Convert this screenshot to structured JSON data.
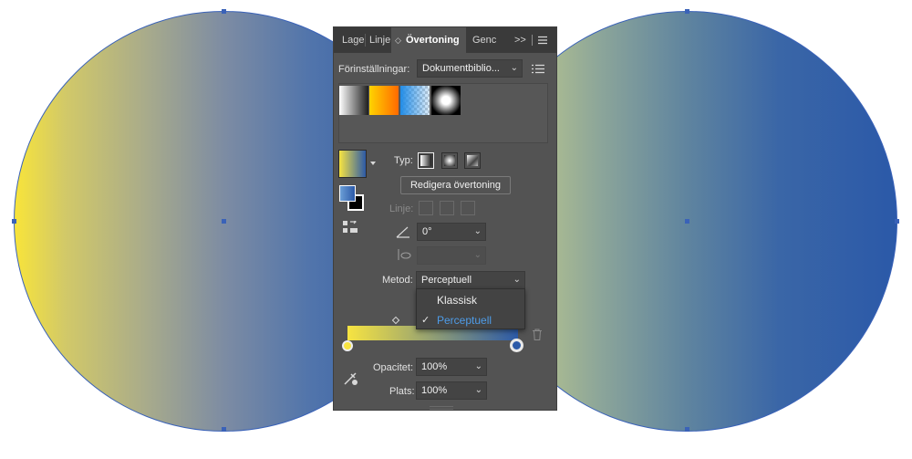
{
  "tabs": [
    "Lage",
    "Linje",
    "Övertoning",
    "Genc"
  ],
  "tab_overflow": ">>",
  "presets": {
    "label": "Förinställningar:",
    "value": "Dokumentbiblio..."
  },
  "type_label": "Typ:",
  "edit_button": "Redigera övertoning",
  "stroke_label": "Linje:",
  "angle_value": "0°",
  "method": {
    "label": "Metod:",
    "value": "Perceptuell",
    "options": [
      "Klassisk",
      "Perceptuell"
    ]
  },
  "opacity": {
    "label": "Opacitet:",
    "value": "100%"
  },
  "location": {
    "label": "Plats:",
    "value": "100%"
  },
  "gradient": {
    "start_color": "#f7e441",
    "end_color": "#2c5aa8"
  },
  "colors": {
    "accent": "#4e9ce8",
    "panel_bg": "#535353",
    "circle_stroke": "#3a62b8"
  },
  "icons": [
    "stroke-gradient-icon",
    "reverse-gradient-icon",
    "angle-icon",
    "aspect-ratio-icon",
    "eyedropper-icon",
    "trash-icon",
    "panel-menu-icon",
    "checkmark-icon"
  ]
}
